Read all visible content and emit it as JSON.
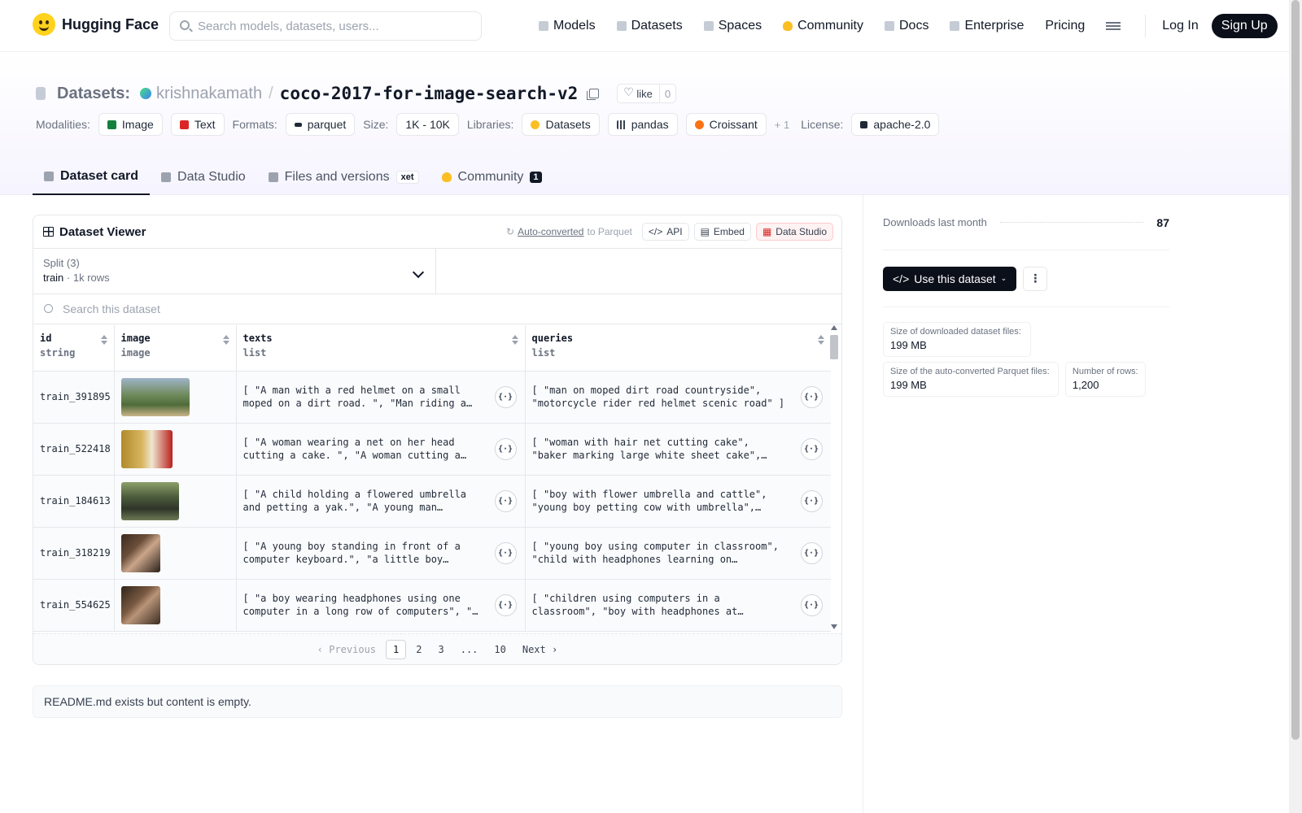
{
  "nav": {
    "brand": "Hugging Face",
    "search_placeholder": "Search models, datasets, users...",
    "links": [
      {
        "label": "Models",
        "icon": "cube-icon"
      },
      {
        "label": "Datasets",
        "icon": "database-icon"
      },
      {
        "label": "Spaces",
        "icon": "grid-icon"
      },
      {
        "label": "Community",
        "icon": "community-icon"
      },
      {
        "label": "Docs",
        "icon": "book-icon"
      },
      {
        "label": "Enterprise",
        "icon": "enterprise-icon"
      },
      {
        "label": "Pricing"
      }
    ],
    "login": "Log In",
    "signup": "Sign Up"
  },
  "header": {
    "section": "Datasets:",
    "owner": "krishnakamath",
    "name": "coco-2017-for-image-search-v2",
    "like_label": "like",
    "like_count": "0",
    "modalities_label": "Modalities:",
    "modalities": [
      "Image",
      "Text"
    ],
    "formats_label": "Formats:",
    "format": "parquet",
    "size_label": "Size:",
    "size": "1K - 10K",
    "libraries_label": "Libraries:",
    "libraries": [
      "Datasets",
      "pandas",
      "Croissant"
    ],
    "libraries_more": "+ 1",
    "license_label": "License:",
    "license": "apache-2.0"
  },
  "tabs": [
    {
      "label": "Dataset card",
      "active": true
    },
    {
      "label": "Data Studio"
    },
    {
      "label": "Files and versions",
      "badge": "xet"
    },
    {
      "label": "Community",
      "count": "1"
    }
  ],
  "viewer": {
    "title": "Dataset Viewer",
    "auto_converted": "Auto-converted",
    "to_parquet": "to Parquet",
    "api": "API",
    "embed": "Embed",
    "data_studio": "Data Studio",
    "split_label": "Split (3)",
    "split_value": "train",
    "split_rows": "1k rows",
    "search_placeholder": "Search this dataset",
    "columns": [
      {
        "name": "id",
        "type": "string"
      },
      {
        "name": "image",
        "type": "image"
      },
      {
        "name": "texts",
        "type": "list"
      },
      {
        "name": "queries",
        "type": "list"
      }
    ],
    "rows": [
      {
        "id": "train_391895",
        "texts": "[ \"A man with a red helmet on a small moped on a dirt road. \", \"Man riding a motor bike on a dirt road on the countryside.\" ]",
        "queries": "[ \"man on moped dirt road countryside\", \"motorcycle rider red helmet scenic road\" ]"
      },
      {
        "id": "train_522418",
        "texts": "[ \"A woman wearing a net on her head cutting a cake. \", \"A woman cutting a large white sheet cake.\" ]",
        "queries": "[ \"woman with hair net cutting cake\", \"baker marking large white sheet cake\", \"kitchen\" ]"
      },
      {
        "id": "train_184613",
        "texts": "[ \"A child holding a flowered umbrella and petting a yak.\", \"A young man holding an umbrella next to a herd of cattle.\" ]",
        "queries": "[ \"boy with flower umbrella and cattle\", \"young boy petting cow with umbrella\", \"herd\" ]"
      },
      {
        "id": "train_318219",
        "texts": "[ \"A young boy standing in front of a computer keyboard.\", \"a little boy wearing headphones and looking at a computer monitor\" ]",
        "queries": "[ \"young boy using computer in classroom\", \"child with headphones learning on computer\" ]"
      },
      {
        "id": "train_554625",
        "texts": "[ \"a boy wearing headphones using one computer in a long row of computers\", \"A little boy with earphones on\" ]",
        "queries": "[ \"children using computers in a classroom\", \"boy with headphones at computer station\", \"lab\" ]"
      }
    ],
    "pager": {
      "prev": "Previous",
      "pages": [
        "1",
        "2",
        "3",
        "...",
        "10"
      ],
      "next": "Next",
      "current": "1"
    }
  },
  "readme": "README.md exists but content is empty.",
  "sidebar": {
    "downloads_label": "Downloads last month",
    "downloads": "87",
    "use_button": "Use this dataset",
    "stats": [
      {
        "label": "Size of downloaded dataset files:",
        "value": "199 MB"
      },
      {
        "label": "Size of the auto-converted Parquet files:",
        "value": "199 MB"
      },
      {
        "label": "Number of rows:",
        "value": "1,200"
      }
    ]
  }
}
